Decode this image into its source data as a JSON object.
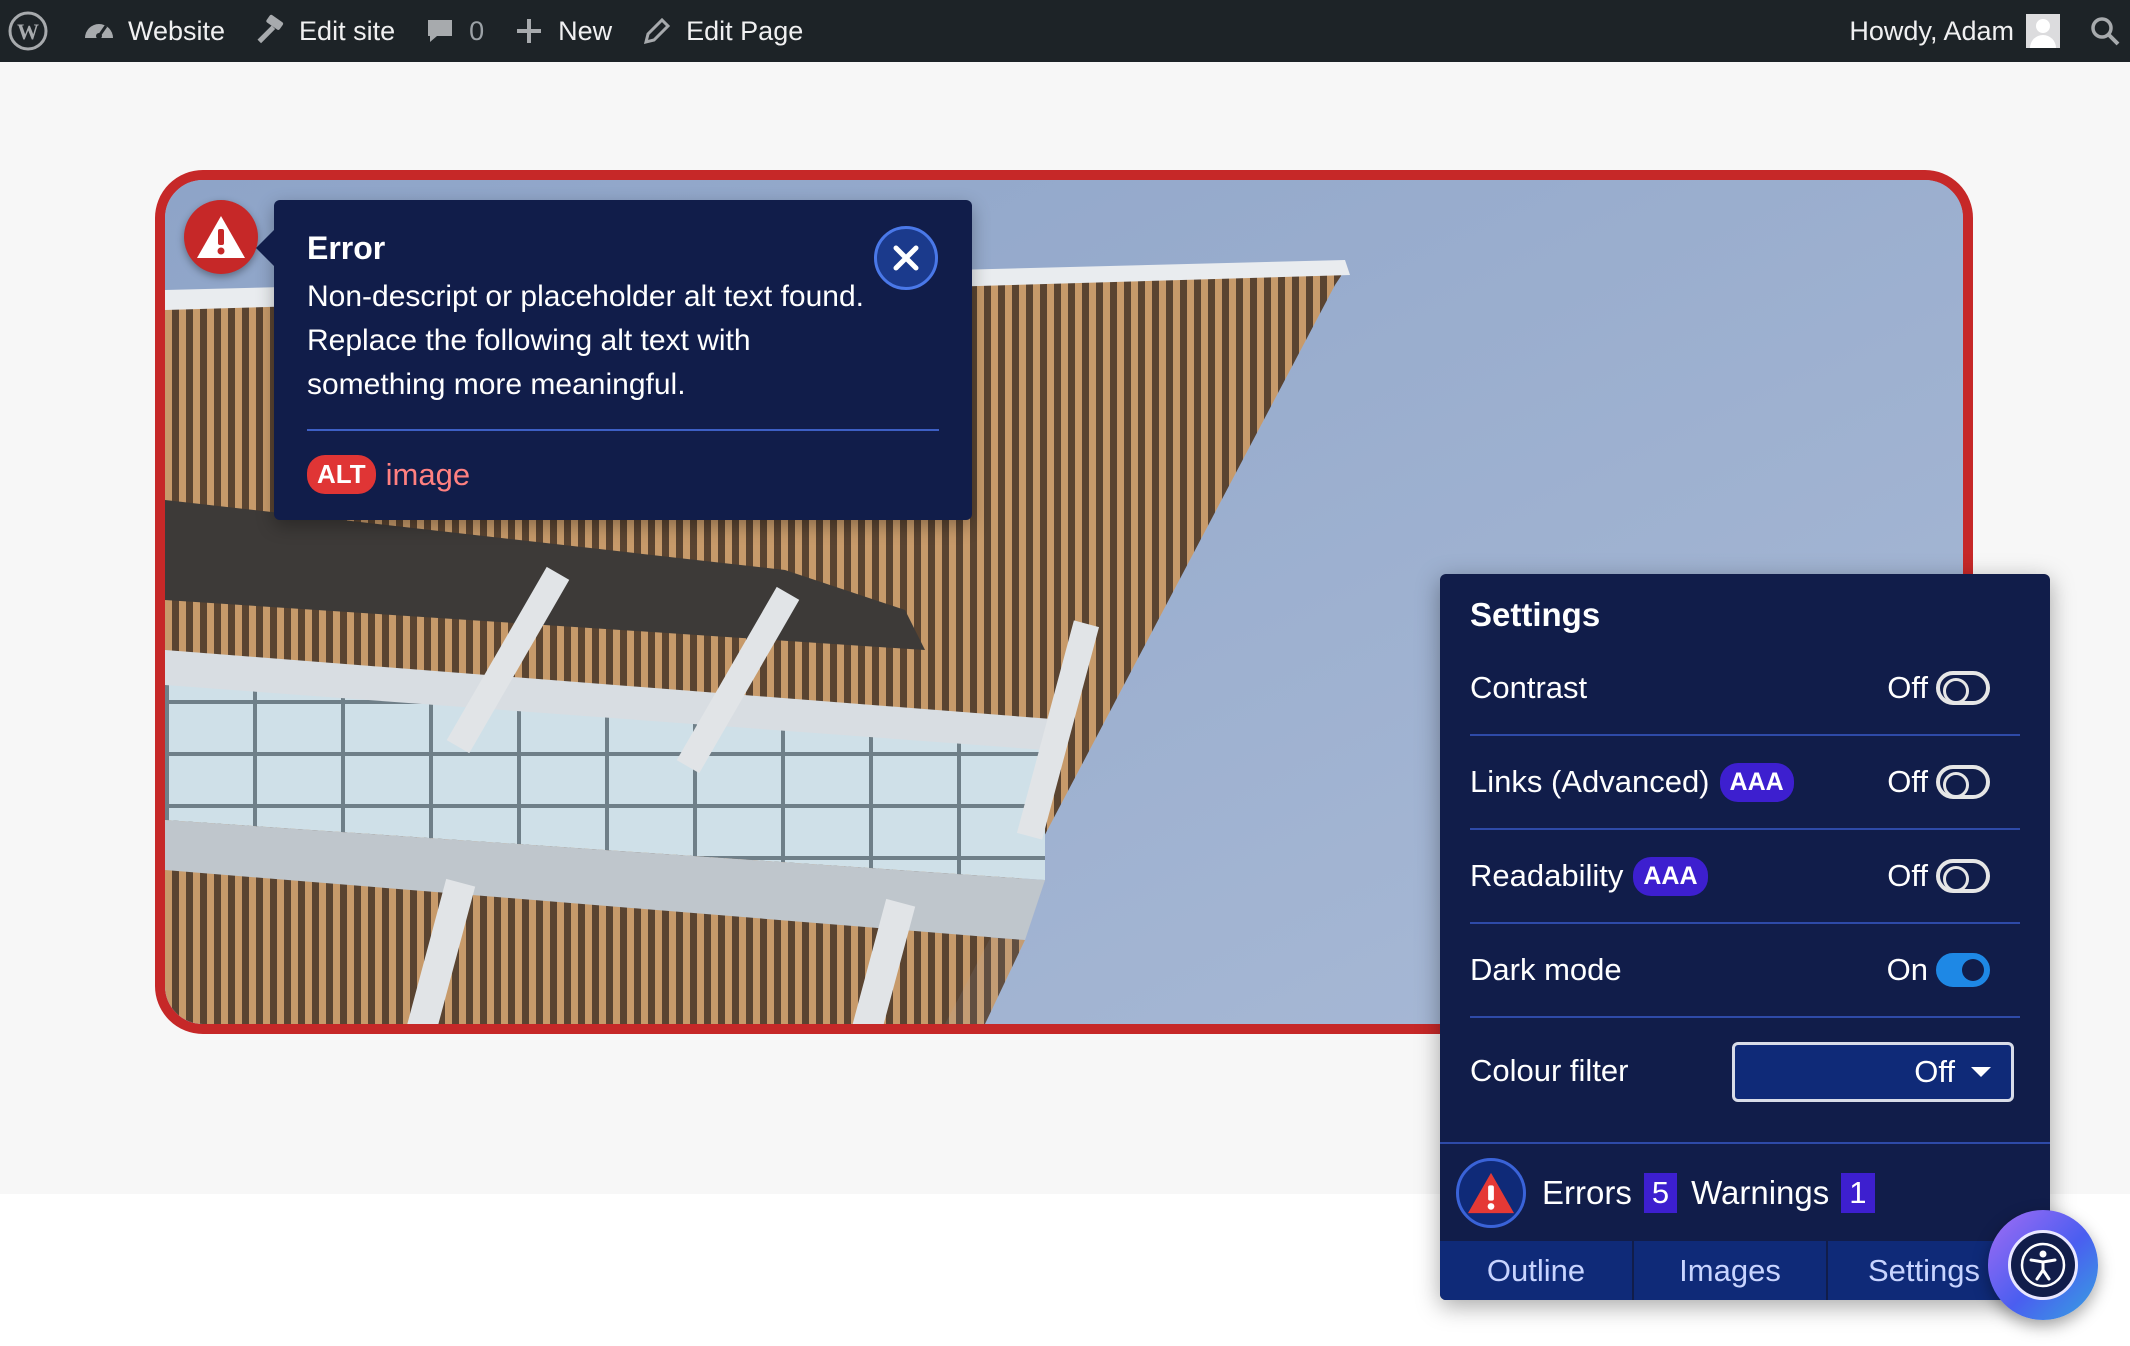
{
  "admin_bar": {
    "site_label": "Website",
    "edit_site_label": "Edit site",
    "comments_count": "0",
    "new_label": "New",
    "edit_page_label": "Edit Page",
    "greeting": "Howdy, Adam"
  },
  "tooltip": {
    "title": "Error",
    "message": "Non-descript or placeholder alt text found. Replace the following alt text with something more meaningful.",
    "alt_badge": "ALT",
    "alt_value": "image"
  },
  "settings": {
    "title": "Settings",
    "rows": [
      {
        "label": "Contrast",
        "badge": "",
        "state": "Off"
      },
      {
        "label": "Links (Advanced)",
        "badge": "AAA",
        "state": "Off"
      },
      {
        "label": "Readability",
        "badge": "AAA",
        "state": "Off"
      },
      {
        "label": "Dark mode",
        "badge": "",
        "state": "On"
      }
    ],
    "colour_filter": {
      "label": "Colour filter",
      "value": "Off"
    }
  },
  "status": {
    "errors_label": "Errors",
    "errors_count": "5",
    "warnings_label": "Warnings",
    "warnings_count": "1"
  },
  "tabs": [
    "Outline",
    "Images",
    "Settings"
  ],
  "colors": {
    "admin_bar": "#1d2327",
    "panel_bg": "#111d4a",
    "error_red": "#c62828",
    "badge_purple": "#3d1fcf",
    "toggle_on": "#1e88e5"
  },
  "icons": [
    "wordpress-icon",
    "dashboard-icon",
    "hammer-icon",
    "comment-icon",
    "plus-icon",
    "pencil-icon",
    "search-icon",
    "warning-icon",
    "close-icon",
    "accessibility-icon"
  ]
}
